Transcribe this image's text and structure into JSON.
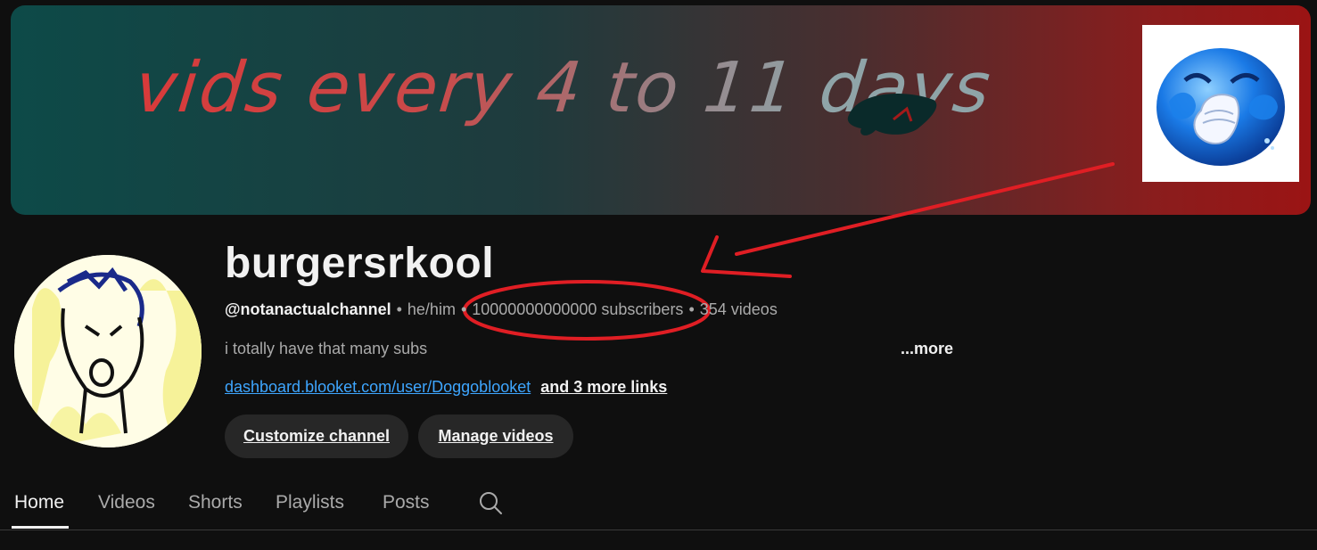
{
  "banner": {
    "text": "vids every 4 to 11 days"
  },
  "channel": {
    "name": "burgersrkool",
    "handle": "@notanactualchannel",
    "pronouns": "he/him",
    "subscribers": "10000000000000 subscribers",
    "videos": "354 videos",
    "separator": "•",
    "description": "i totally have that many subs",
    "more_label": "...more",
    "link_text": "dashboard.blooket.com/user/Doggoblooket",
    "more_links_text": "and 3 more links"
  },
  "buttons": {
    "customize": "Customize channel",
    "manage": "Manage videos"
  },
  "tabs": [
    {
      "label": "Home",
      "active": true
    },
    {
      "label": "Videos",
      "active": false
    },
    {
      "label": "Shorts",
      "active": false
    },
    {
      "label": "Playlists",
      "active": false
    },
    {
      "label": "Posts",
      "active": false
    }
  ],
  "icons": {
    "search": "search-icon"
  },
  "colors": {
    "background": "#0f0f0f",
    "link": "#3ea6ff",
    "annotation": "#e01e24",
    "button_bg": "#272727"
  }
}
